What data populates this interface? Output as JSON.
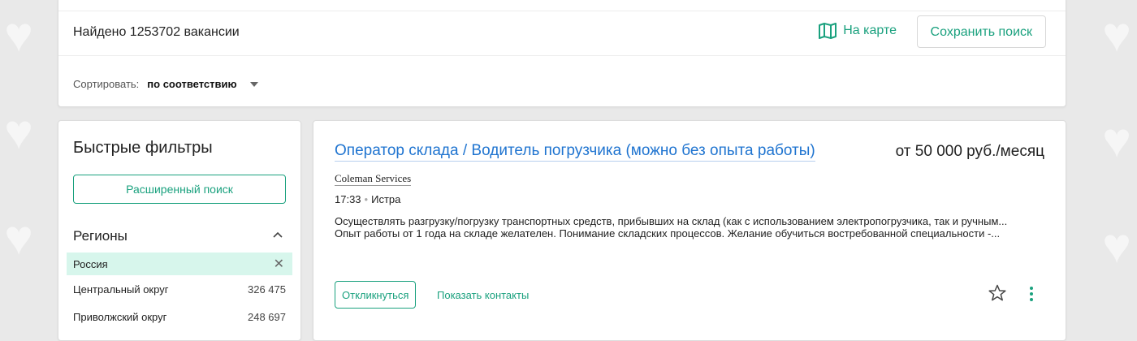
{
  "header": {
    "found": "Найдено 1253702 вакансии",
    "map_link": "На карте",
    "save_search": "Сохранить поиск",
    "sort_label": "Сортировать:",
    "sort_value": "по соответствию"
  },
  "filters": {
    "title": "Быстрые фильтры",
    "advanced_search": "Расширенный поиск",
    "regions_title": "Регионы",
    "selected_region": "Россия",
    "regions": [
      {
        "name": "Центральный округ",
        "count": "326 475"
      },
      {
        "name": "Приволжский округ",
        "count": "248 697"
      }
    ]
  },
  "vacancy": {
    "title": "Оператор склада / Водитель погрузчика (можно без опыта работы)",
    "salary": "от 50 000 руб./месяц",
    "company": "Coleman Services",
    "time": "17:33",
    "city": "Истра",
    "desc_line1": "Осуществлять разгрузку/погрузку транспортных средств, прибывших на склад (как с использованием электропогрузчика, так и ручным...",
    "desc_line2": "Опыт работы от 1 года на складе желателен. Понимание складских процессов. Желание обучиться востребованной специальности -...",
    "respond": "Откликнуться",
    "show_contacts": "Показать контакты"
  },
  "colors": {
    "accent": "#1aa17e",
    "link": "#1f74d0",
    "selected_bg": "#d7f6ec"
  }
}
